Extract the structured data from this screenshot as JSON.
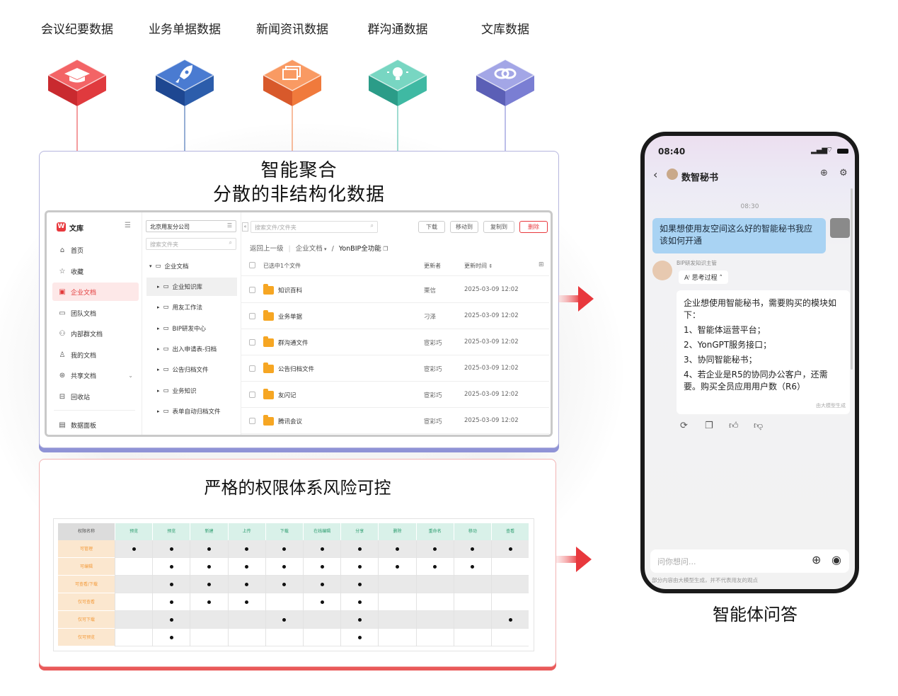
{
  "sources": [
    {
      "label": "会议纪要数据",
      "icon": "graduation-cap-icon",
      "color": "#e8383d"
    },
    {
      "label": "业务单据数据",
      "icon": "rocket-icon",
      "color": "#2c5dab"
    },
    {
      "label": "新闻资讯数据",
      "icon": "layers-icon",
      "color": "#f07a3c"
    },
    {
      "label": "群沟通数据",
      "icon": "lightbulb-icon",
      "color": "#3fb9a3"
    },
    {
      "label": "文库数据",
      "icon": "link-icon",
      "color": "#7a7ed3"
    }
  ],
  "panel1": {
    "title_line1": "智能聚合",
    "title_line2": "分散的非结构化数据"
  },
  "app": {
    "brand": "文库",
    "sidebar": [
      {
        "label": "首页",
        "icon": "home-icon"
      },
      {
        "label": "收藏",
        "icon": "star-icon"
      },
      {
        "label": "企业文档",
        "icon": "enterprise-doc-icon",
        "active": true
      },
      {
        "label": "团队文档",
        "icon": "team-doc-icon"
      },
      {
        "label": "内部群文档",
        "icon": "group-doc-icon"
      },
      {
        "label": "我的文档",
        "icon": "user-doc-icon"
      },
      {
        "label": "共享文档",
        "icon": "share-icon"
      },
      {
        "label": "回收站",
        "icon": "trash-icon"
      },
      {
        "label": "数据面板",
        "icon": "dashboard-icon"
      }
    ],
    "org": "北京用友分公司",
    "tree_search_placeholder": "搜索文件夹",
    "tree": [
      {
        "label": "企业文档",
        "level": 0
      },
      {
        "label": "企业知识库",
        "level": 1,
        "active": true
      },
      {
        "label": "用友工作法",
        "level": 1
      },
      {
        "label": "BIP研发中心",
        "level": 1
      },
      {
        "label": "出入申请表-归档",
        "level": 1
      },
      {
        "label": "公告归档文件",
        "level": 1
      },
      {
        "label": "业务知识",
        "level": 1
      },
      {
        "label": "表单自动归档文件",
        "level": 1
      }
    ],
    "search_placeholder": "搜索文件/文件夹",
    "buttons": {
      "download": "下载",
      "move": "移动到",
      "copy": "复制到",
      "delete": "删除"
    },
    "breadcrumb": {
      "back": "返回上一级",
      "parent": "企业文档",
      "current": "YonBIP全功能"
    },
    "table_header": {
      "selected": "已选中1个文件",
      "updater": "更新者",
      "updated": "更新时间"
    },
    "files": [
      {
        "name": "知识百科",
        "updater": "栗信",
        "time": "2025-03-09 12:02"
      },
      {
        "name": "业务单据",
        "updater": "刁泽",
        "time": "2025-03-09 12:02"
      },
      {
        "name": "群沟通文件",
        "updater": "宦彩巧",
        "time": "2025-03-09 12:02"
      },
      {
        "name": "公告归档文件",
        "updater": "宦彩巧",
        "time": "2025-03-09 12:02"
      },
      {
        "name": "友闪记",
        "updater": "宦彩巧",
        "time": "2025-03-09 12:02"
      },
      {
        "name": "腾讯会议",
        "updater": "宦彩巧",
        "time": "2025-03-09 12:02"
      }
    ]
  },
  "panel2": {
    "title": "严格的权限体系风险可控",
    "permissions": {
      "corner": "权限名称",
      "columns": [
        "预览",
        "预览",
        "新建",
        "上传",
        "下载",
        "在线编辑",
        "分享",
        "删除",
        "重命名",
        "移动",
        "查看"
      ],
      "rows": [
        {
          "label": "可管理",
          "cells": [
            1,
            1,
            1,
            1,
            1,
            1,
            1,
            1,
            1,
            1,
            1
          ]
        },
        {
          "label": "可编辑",
          "cells": [
            0,
            1,
            1,
            1,
            1,
            1,
            1,
            1,
            1,
            1,
            0
          ]
        },
        {
          "label": "可查看/下载",
          "cells": [
            0,
            1,
            1,
            1,
            1,
            1,
            1,
            0,
            0,
            0,
            0
          ]
        },
        {
          "label": "仅可查看",
          "cells": [
            0,
            1,
            1,
            1,
            0,
            1,
            1,
            0,
            0,
            0,
            0
          ]
        },
        {
          "label": "仅可下载",
          "cells": [
            0,
            1,
            0,
            0,
            1,
            0,
            1,
            0,
            0,
            0,
            1
          ]
        },
        {
          "label": "仅可预览",
          "cells": [
            0,
            1,
            0,
            0,
            0,
            0,
            1,
            0,
            0,
            0,
            0
          ]
        }
      ]
    }
  },
  "phone": {
    "time": "08:40",
    "chat_title": "数智秘书",
    "timestamp": "08:30",
    "user_message": "如果想使用友空间这么好的智能秘书我应该如何开通",
    "bot_name": "BIP研发知识主管",
    "thinking": "思考过程",
    "answer_intro": "企业想使用智能秘书，需要购买的模块如下：",
    "answer_items": [
      "1、智能体运营平台；",
      "2、YonGPT服务接口；",
      "3、协同智能秘书；",
      "4、若企业是R5的协同办公客户，还需要。购买全员应用用户数（R6）"
    ],
    "generated_tag": "由大模型生成",
    "input_placeholder": "问你想问...",
    "disclaimer": "部分内容由大模型生成，并不代表用友的观点",
    "caption": "智能体问答"
  },
  "colors": {
    "accent_red": "#e8383d",
    "panel1_border": "#8f93d6",
    "panel2_border": "#e95a5a",
    "perm_header": "#d9f1e9",
    "perm_label": "#f39a3a"
  }
}
